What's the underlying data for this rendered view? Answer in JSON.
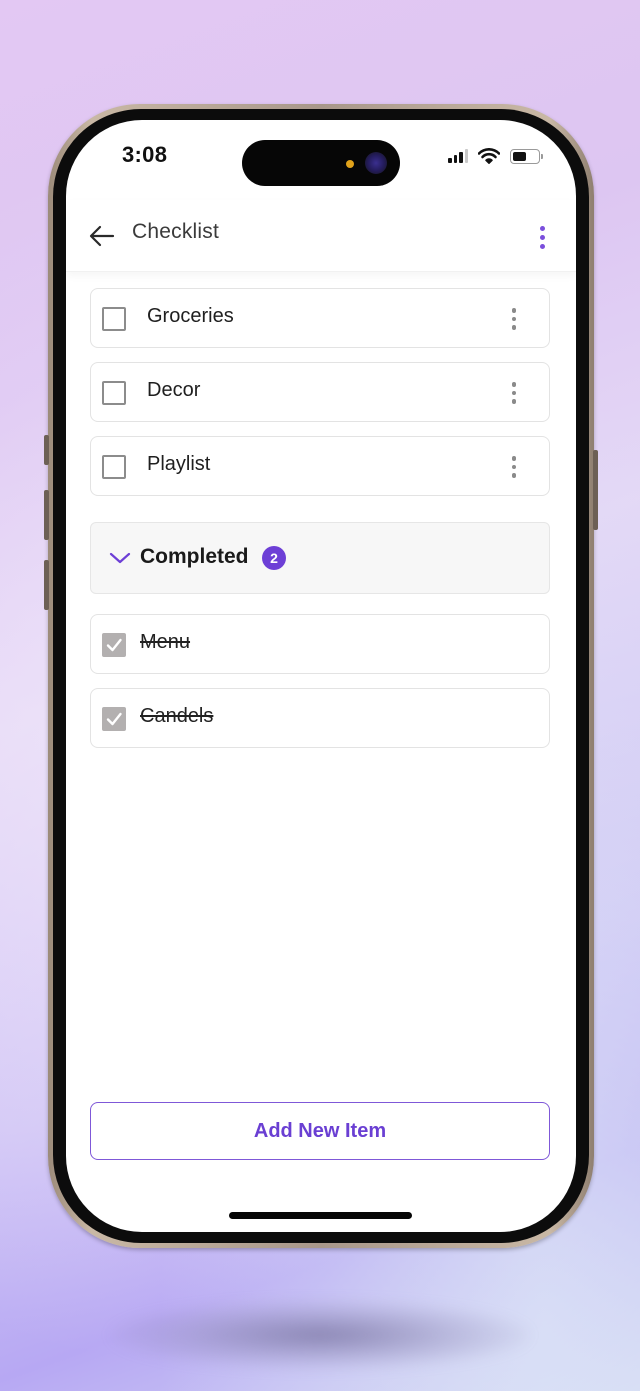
{
  "status_bar": {
    "time": "3:08",
    "icons": [
      "cellular-signal-icon",
      "wifi-icon",
      "battery-icon"
    ],
    "battery_level": 0.55
  },
  "app_bar": {
    "title": "Checklist",
    "back_icon": "arrow-left-icon",
    "menu_icon": "more-vertical-icon"
  },
  "items": [
    {
      "label": "Groceries",
      "checked": false
    },
    {
      "label": "Decor",
      "checked": false
    },
    {
      "label": "Playlist",
      "checked": false
    }
  ],
  "completed_section": {
    "title": "Completed",
    "count": "2",
    "expanded": true,
    "items": [
      {
        "label": "Menu",
        "checked": true
      },
      {
        "label": "Candels",
        "checked": true
      }
    ]
  },
  "actions": {
    "add_item_label": "Add New Item"
  },
  "colors": {
    "accent": "#6d3fd6",
    "checked_box": "#b3b0b0",
    "card_border": "#e3e3e3"
  }
}
